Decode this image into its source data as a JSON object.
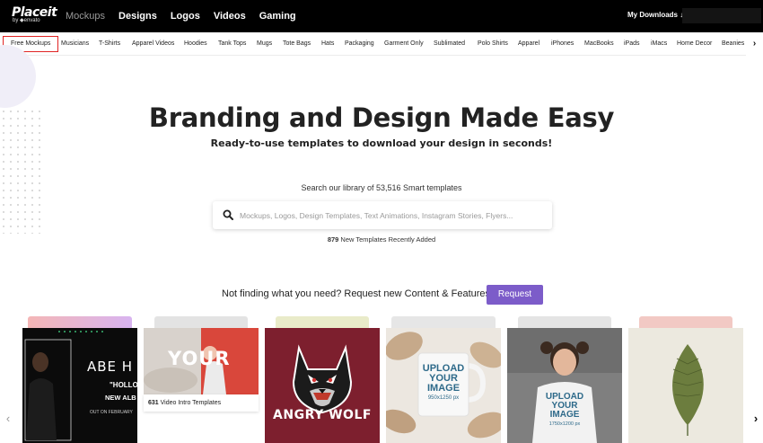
{
  "header": {
    "logo_main": "Placeit",
    "logo_sub": "by ◆envato",
    "nav": [
      "Mockups",
      "Designs",
      "Logos",
      "Videos",
      "Gaming"
    ],
    "downloads_label": "My Downloads ↓"
  },
  "categories": {
    "items": [
      "Free Mockups",
      "Musicians",
      "T-Shirts",
      "Apparel Videos",
      "Hoodies",
      "Tank Tops",
      "Mugs",
      "Tote Bags",
      "Hats",
      "Packaging",
      "Garment Only",
      "Sublimated",
      "Polo Shirts",
      "Apparel",
      "iPhones",
      "MacBooks",
      "iPads",
      "iMacs",
      "Home Decor",
      "Beanies"
    ],
    "next_icon": "›"
  },
  "hero": {
    "title": "Branding and Design Made Easy",
    "subtitle": "Ready-to-use templates to download your design in seconds!"
  },
  "search": {
    "caption": "Search our library of 53,516 Smart templates",
    "placeholder": "Mockups, Logos, Design Templates, Text Animations, Instagram Stories, Flyers...",
    "new_count": "879",
    "new_label": " New Templates Recently Added"
  },
  "request": {
    "text": "Not finding what you need? Request new Content & Features",
    "button": "Request"
  },
  "cards": {
    "card1": {
      "line1": "ABE H",
      "line2": "\"HOLLOV",
      "line3": "NEW ALB",
      "line4": "OUT ON FEBRUARY"
    },
    "card2": {
      "title": "YOUR",
      "caption_count": "631",
      "caption_label": " Video Intro Templates"
    },
    "card3": {
      "title": "ANGRY WOLF"
    },
    "card4": {
      "line1": "UPLOAD",
      "line2": "YOUR",
      "line3": "IMAGE",
      "line4": "950x1250 px"
    },
    "card5": {
      "line1": "UPLOAD",
      "line2": "YOUR",
      "line3": "IMAGE",
      "line4": "1750x1200 px"
    }
  },
  "arrows": {
    "left": "‹",
    "right": "›"
  },
  "colors": {
    "accent": "#7c5cc9",
    "active_border": "#e02424",
    "topbar": "#000000"
  }
}
